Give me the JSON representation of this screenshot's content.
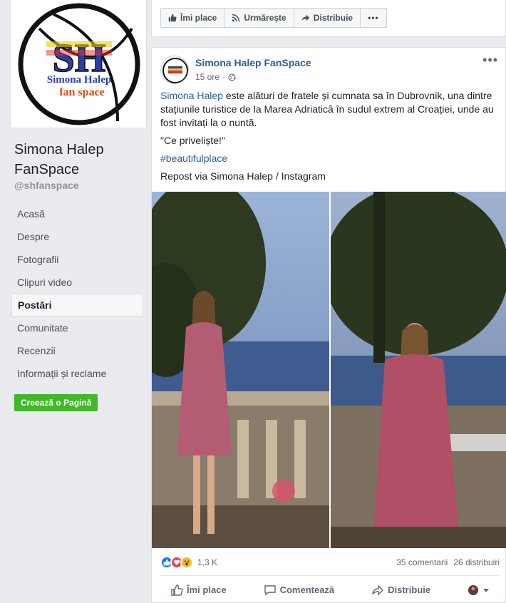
{
  "sidebar": {
    "logo_letters": "SH",
    "logo_text_line1": "Simona Halep",
    "logo_text_line2": "fan space",
    "page_name": "Simona Halep FanSpace",
    "handle": "@shfanspace",
    "nav": [
      {
        "label": "Acasă",
        "active": false
      },
      {
        "label": "Despre",
        "active": false
      },
      {
        "label": "Fotografii",
        "active": false
      },
      {
        "label": "Clipuri video",
        "active": false
      },
      {
        "label": "Postări",
        "active": true
      },
      {
        "label": "Comunitate",
        "active": false
      },
      {
        "label": "Recenzii",
        "active": false
      },
      {
        "label": "Informații și reclame",
        "active": false
      }
    ],
    "create_page_label": "Creează o Pagină"
  },
  "top_actions": {
    "like": "Îmi place",
    "follow": "Urmărește",
    "share": "Distribuie",
    "more": "•••"
  },
  "post": {
    "author": "Simona Halep FanSpace",
    "time": "15 ore",
    "separator": "·",
    "more": "•••",
    "mention": "Simona Halep",
    "body": " este alături de fratele și cumnata sa în Dubrovnik, una dintre stațiunile turistice de la Marea Adriatică în sudul extrem al Croației, unde au fost invitați la o nuntă.",
    "quote": "\"Ce priveliște!\"",
    "hashtag": "#beautifulplace",
    "repost": "Repost via Simona Halep / Instagram",
    "reaction_count": "1,3 K",
    "comments": "35 comentarii",
    "shares": "26 distribuiri",
    "actions": {
      "like": "Îmi place",
      "comment": "Comentează",
      "share": "Distribuie"
    }
  },
  "colors": {
    "link": "#365899",
    "create_button": "#42b72a",
    "like_blue": "#1877f2",
    "love_red": "#f33e58",
    "wow_yellow": "#f7b928"
  }
}
